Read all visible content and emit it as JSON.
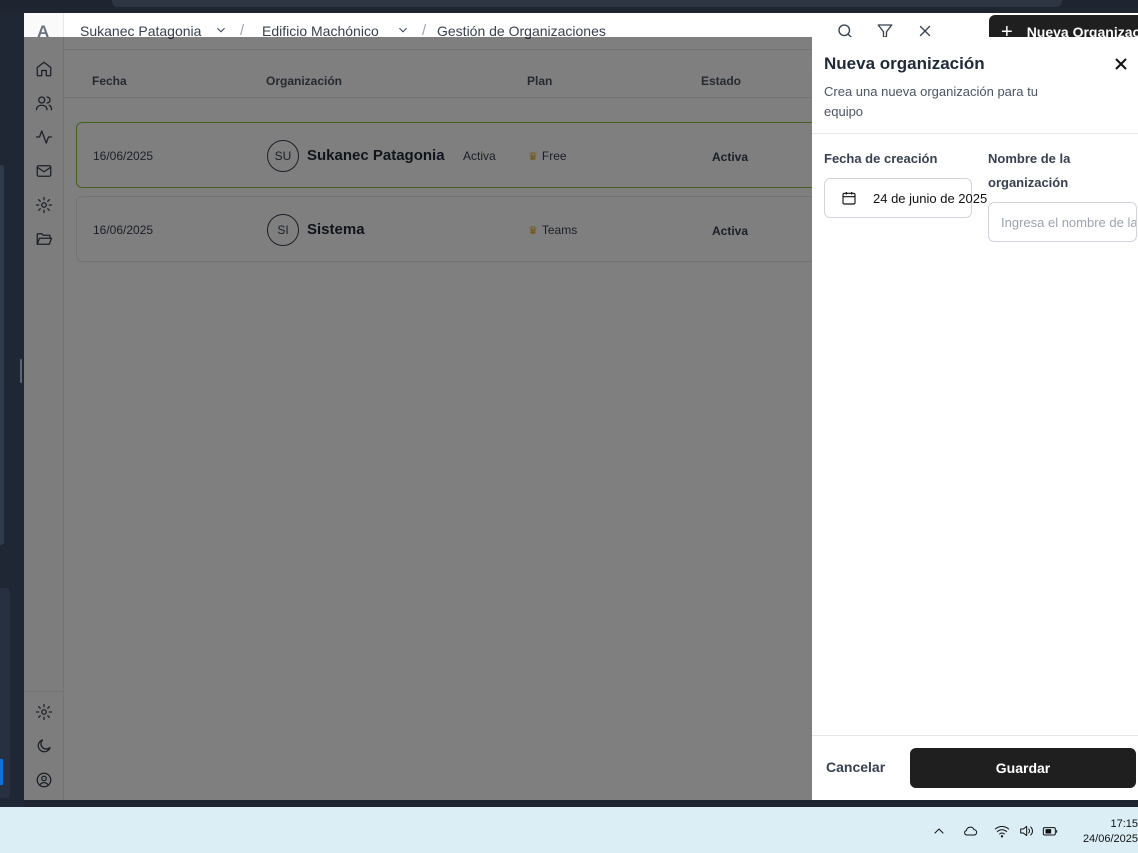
{
  "app": {
    "logo": "A"
  },
  "breadcrumb": {
    "org": "Sukanec Patagonia",
    "building": "Edificio Machónico",
    "separator": "/",
    "page": "Gestión de Organizaciones"
  },
  "toolbar": {
    "new_org_label": "Nueva Organización",
    "new_org_plus": "+"
  },
  "table": {
    "headers": [
      "Fecha",
      "Organización",
      "Plan",
      "Estado"
    ],
    "rows": [
      {
        "fecha": "16/06/2025",
        "initials": "SU",
        "name": "Sukanec Patagonia",
        "status_tag": "Activa",
        "plan": "Free",
        "estado": "Activa",
        "plan_icon": "crown-icon"
      },
      {
        "fecha": "16/06/2025",
        "initials": "SI",
        "name": "Sistema",
        "status_tag": "",
        "plan": "Teams",
        "estado": "Activa",
        "plan_icon": "crown-icon"
      }
    ]
  },
  "drawer": {
    "title": "Nueva organización",
    "description": "Crea una nueva organización para tu equipo",
    "date_label": "Fecha de creación",
    "date_value": "24 de junio de 2025",
    "name_label": "Nombre de la organización",
    "name_placeholder": "Ingresa el nombre de la organización",
    "name_value": "",
    "cancel_label": "Cancelar",
    "save_label": "Guardar"
  },
  "taskbar": {
    "time": "17:15",
    "date": "24/06/2025"
  },
  "colors": {
    "primary": "#1f1f1f",
    "active_row_border": "#86c43f",
    "crown": "#e0a418",
    "taskbar": "#dbeef6"
  }
}
